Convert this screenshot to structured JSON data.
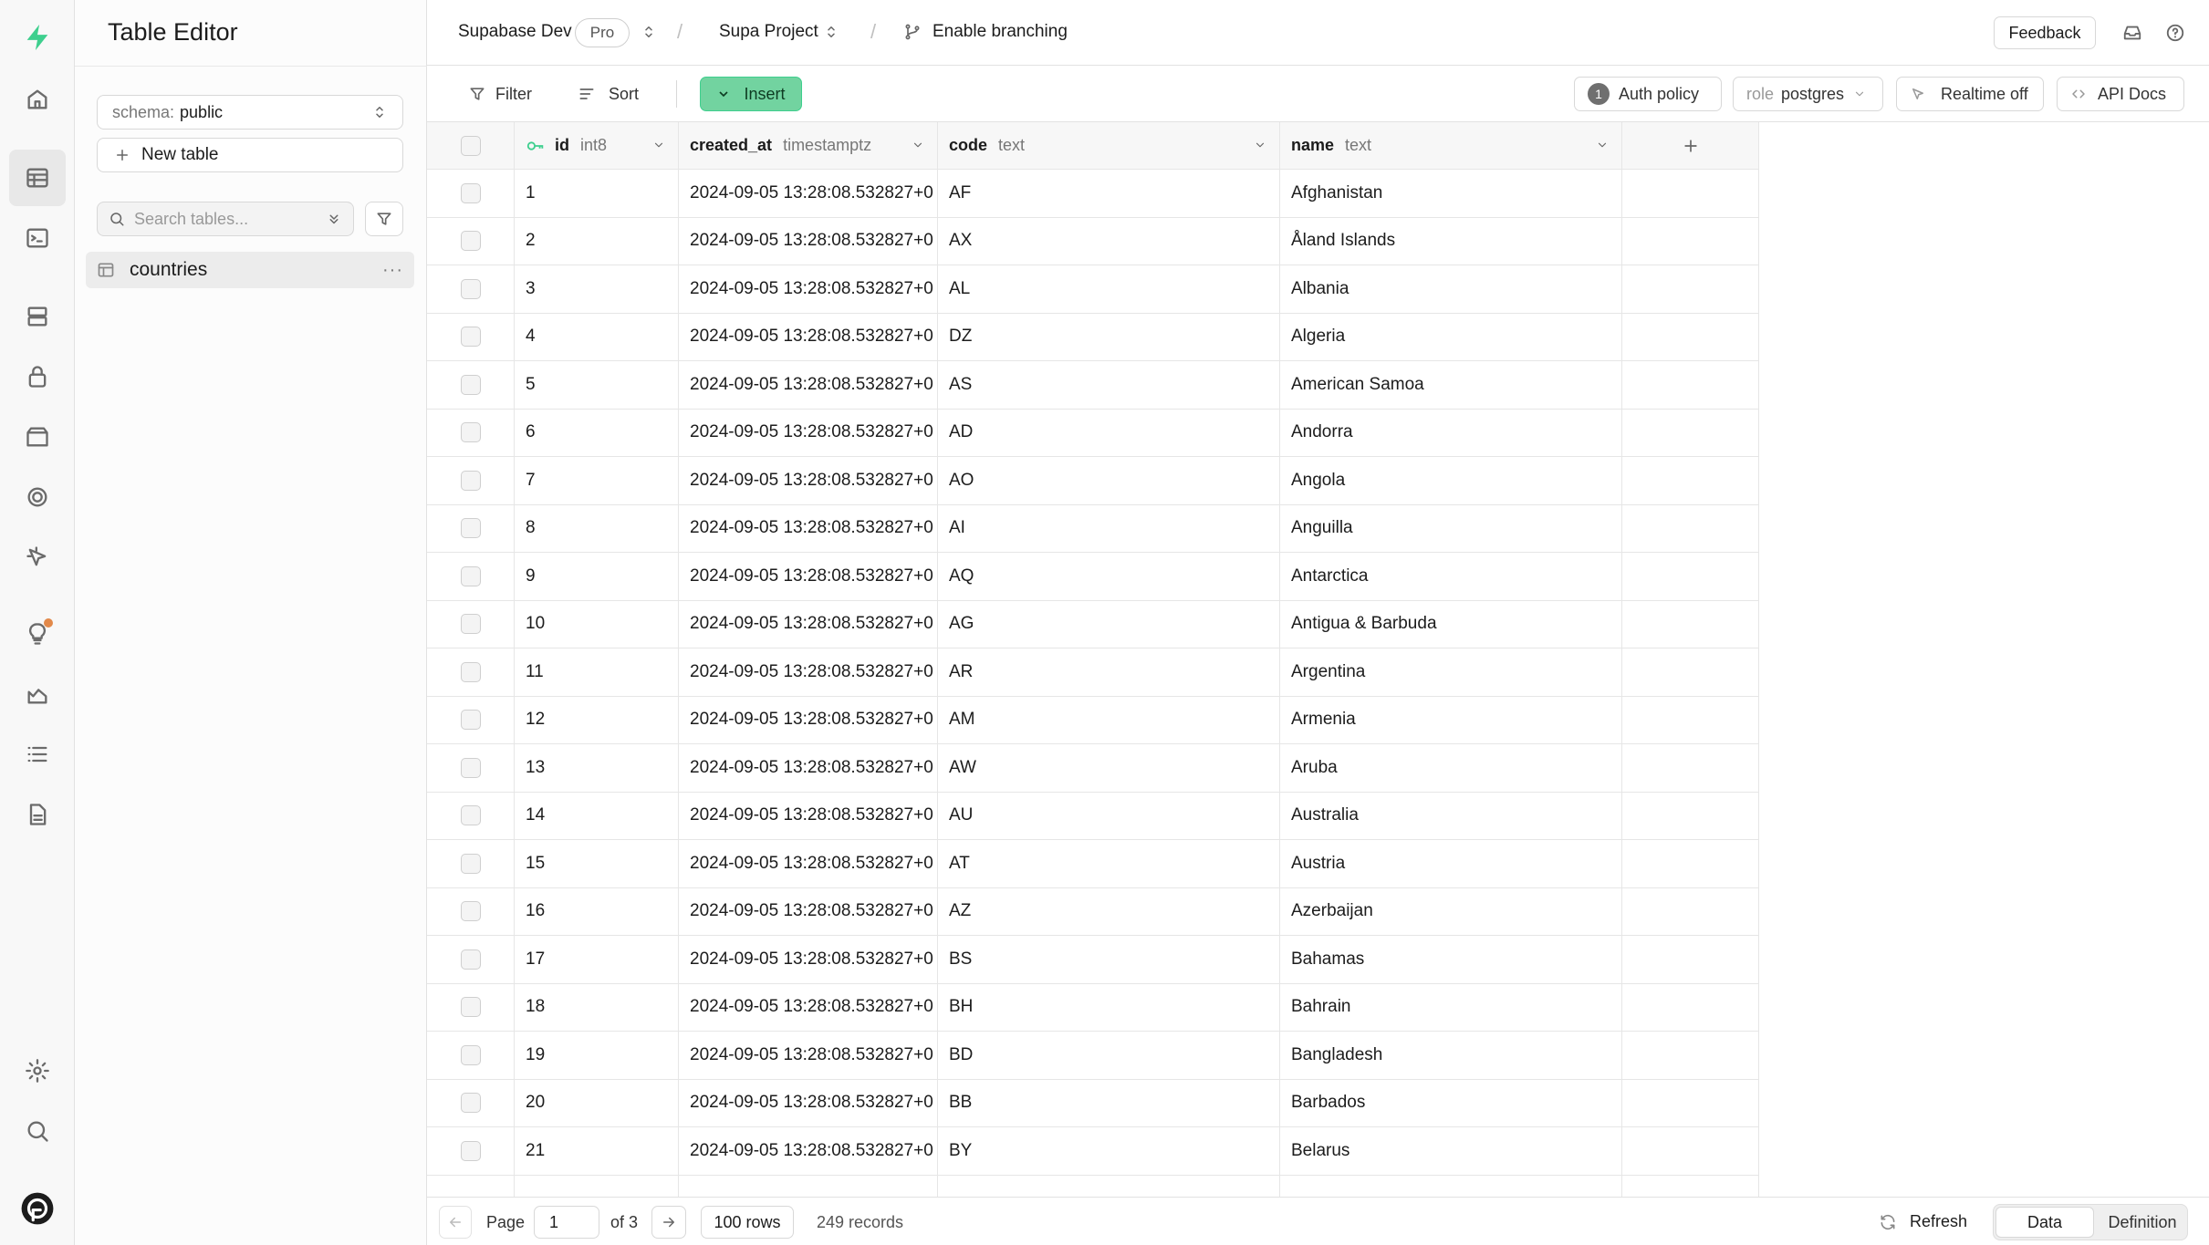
{
  "sidebar": {
    "title": "Table Editor",
    "schema_label": "schema:",
    "schema_value": "public",
    "new_table_label": "New table",
    "search_placeholder": "Search tables...",
    "tables": [
      {
        "name": "countries"
      }
    ]
  },
  "topbar": {
    "org": "Supabase Dev",
    "plan_badge": "Pro",
    "project": "Supa Project",
    "branching": "Enable branching",
    "feedback": "Feedback"
  },
  "toolbar": {
    "filter": "Filter",
    "sort": "Sort",
    "insert": "Insert",
    "auth_policy_count": "1",
    "auth_policy": "Auth policy",
    "role_label": "role",
    "role_value": "postgres",
    "realtime": "Realtime off",
    "api_docs": "API Docs"
  },
  "grid": {
    "columns": [
      {
        "name": "id",
        "type": "int8",
        "primary_key": true
      },
      {
        "name": "created_at",
        "type": "timestamptz"
      },
      {
        "name": "code",
        "type": "text"
      },
      {
        "name": "name",
        "type": "text"
      }
    ],
    "rows": [
      {
        "id": "1",
        "created_at": "2024-09-05 13:28:08.532827+0",
        "code": "AF",
        "name": "Afghanistan"
      },
      {
        "id": "2",
        "created_at": "2024-09-05 13:28:08.532827+0",
        "code": "AX",
        "name": "Åland Islands"
      },
      {
        "id": "3",
        "created_at": "2024-09-05 13:28:08.532827+0",
        "code": "AL",
        "name": "Albania"
      },
      {
        "id": "4",
        "created_at": "2024-09-05 13:28:08.532827+0",
        "code": "DZ",
        "name": "Algeria"
      },
      {
        "id": "5",
        "created_at": "2024-09-05 13:28:08.532827+0",
        "code": "AS",
        "name": "American Samoa"
      },
      {
        "id": "6",
        "created_at": "2024-09-05 13:28:08.532827+0",
        "code": "AD",
        "name": "Andorra"
      },
      {
        "id": "7",
        "created_at": "2024-09-05 13:28:08.532827+0",
        "code": "AO",
        "name": "Angola"
      },
      {
        "id": "8",
        "created_at": "2024-09-05 13:28:08.532827+0",
        "code": "AI",
        "name": "Anguilla"
      },
      {
        "id": "9",
        "created_at": "2024-09-05 13:28:08.532827+0",
        "code": "AQ",
        "name": "Antarctica"
      },
      {
        "id": "10",
        "created_at": "2024-09-05 13:28:08.532827+0",
        "code": "AG",
        "name": "Antigua & Barbuda"
      },
      {
        "id": "11",
        "created_at": "2024-09-05 13:28:08.532827+0",
        "code": "AR",
        "name": "Argentina"
      },
      {
        "id": "12",
        "created_at": "2024-09-05 13:28:08.532827+0",
        "code": "AM",
        "name": "Armenia"
      },
      {
        "id": "13",
        "created_at": "2024-09-05 13:28:08.532827+0",
        "code": "AW",
        "name": "Aruba"
      },
      {
        "id": "14",
        "created_at": "2024-09-05 13:28:08.532827+0",
        "code": "AU",
        "name": "Australia"
      },
      {
        "id": "15",
        "created_at": "2024-09-05 13:28:08.532827+0",
        "code": "AT",
        "name": "Austria"
      },
      {
        "id": "16",
        "created_at": "2024-09-05 13:28:08.532827+0",
        "code": "AZ",
        "name": "Azerbaijan"
      },
      {
        "id": "17",
        "created_at": "2024-09-05 13:28:08.532827+0",
        "code": "BS",
        "name": "Bahamas"
      },
      {
        "id": "18",
        "created_at": "2024-09-05 13:28:08.532827+0",
        "code": "BH",
        "name": "Bahrain"
      },
      {
        "id": "19",
        "created_at": "2024-09-05 13:28:08.532827+0",
        "code": "BD",
        "name": "Bangladesh"
      },
      {
        "id": "20",
        "created_at": "2024-09-05 13:28:08.532827+0",
        "code": "BB",
        "name": "Barbados"
      },
      {
        "id": "21",
        "created_at": "2024-09-05 13:28:08.532827+0",
        "code": "BY",
        "name": "Belarus"
      }
    ]
  },
  "footer": {
    "page_label": "Page",
    "page_value": "1",
    "page_total": "of 3",
    "rows_per_page": "100 rows",
    "records": "249 records",
    "refresh": "Refresh",
    "tab_data": "Data",
    "tab_definition": "Definition"
  },
  "icons": {
    "brand": "supabase-logo-icon",
    "rail": [
      "home-icon",
      "table-editor-icon",
      "sql-editor-icon",
      "database-icon",
      "auth-icon",
      "storage-icon",
      "edge-functions-icon",
      "realtime-icon",
      "advisors-icon",
      "reports-icon",
      "logs-icon",
      "api-docs-icon",
      "settings-icon",
      "search-icon",
      "user-avatar-icon"
    ]
  },
  "colors": {
    "brand_green": "#3ecf8e",
    "insert_bg": "#72d3a0",
    "notification_dot": "#e2894a"
  }
}
